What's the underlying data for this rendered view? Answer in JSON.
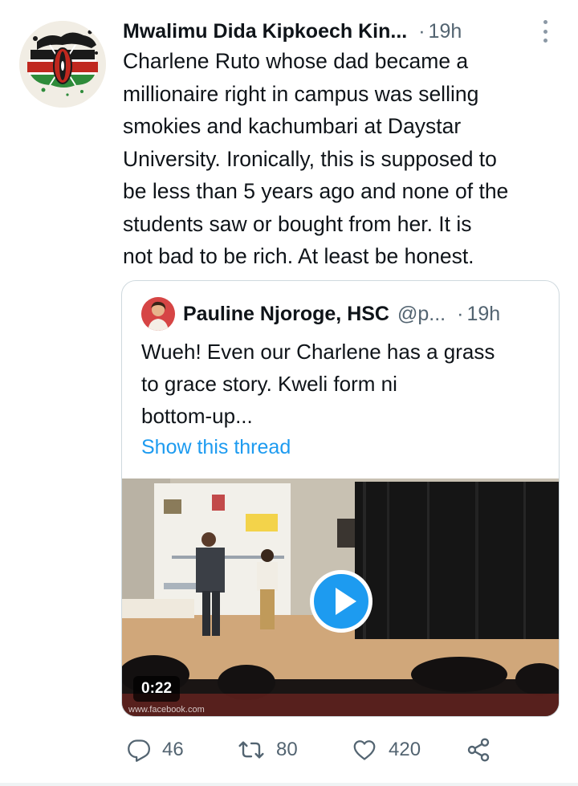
{
  "tweet": {
    "author_name": "Mwalimu Dida Kipkoech Kin...",
    "separator": "·",
    "time": "19h",
    "text": "Charlene Ruto whose dad became a\nmillionaire right in campus was selling\nsmokies and kachumbari at Daystar\nUniversity. Ironically, this is supposed to\nbe less than 5 years ago and none of the\nstudents saw or bought from her. It is\nnot bad to be rich. At least be honest."
  },
  "quoted": {
    "author_name": "Pauline Njoroge, HSC",
    "handle": "@p...",
    "separator": "·",
    "time": "19h",
    "text": "Wueh! Even our Charlene has a grass\nto grace story. Kweli form ni\nbottom-up...",
    "show_thread": "Show this thread",
    "video": {
      "duration": "0:22",
      "watermark": "www.facebook.com"
    }
  },
  "actions": {
    "replies": "46",
    "retweets": "80",
    "likes": "420"
  },
  "icons": [
    "more-icon",
    "reply-icon",
    "retweet-icon",
    "like-icon",
    "share-icon",
    "play-icon"
  ],
  "colors": {
    "accent": "#1d9bf0",
    "secondary_text": "#536471",
    "primary_text": "#0f1419",
    "border": "#cfd9de"
  }
}
